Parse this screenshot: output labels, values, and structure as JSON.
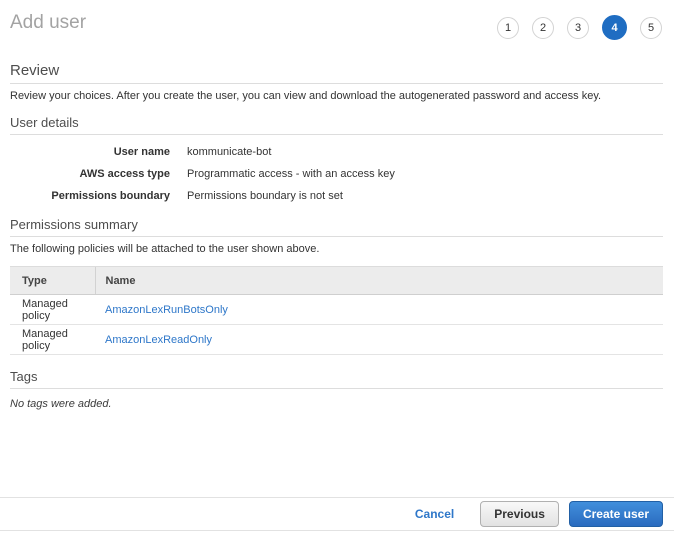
{
  "page": {
    "title": "Add user"
  },
  "steps": {
    "items": [
      "1",
      "2",
      "3",
      "4",
      "5"
    ],
    "active_step": "4"
  },
  "review": {
    "heading": "Review",
    "description": "Review your choices. After you create the user, you can view and download the autogenerated password and access key."
  },
  "user_details": {
    "heading": "User details",
    "rows": [
      {
        "label": "User name",
        "value": "kommunicate-bot"
      },
      {
        "label": "AWS access type",
        "value": "Programmatic access - with an access key"
      },
      {
        "label": "Permissions boundary",
        "value": "Permissions boundary is not set"
      }
    ]
  },
  "permissions_summary": {
    "heading": "Permissions summary",
    "description": "The following policies will be attached to the user shown above.",
    "table": {
      "columns": [
        "Type",
        "Name"
      ],
      "rows": [
        {
          "type": "Managed policy",
          "name": "AmazonLexRunBotsOnly"
        },
        {
          "type": "Managed policy",
          "name": "AmazonLexReadOnly"
        }
      ]
    }
  },
  "tags": {
    "heading": "Tags",
    "empty_message": "No tags were added."
  },
  "footer": {
    "cancel_label": "Cancel",
    "previous_label": "Previous",
    "create_label": "Create user"
  },
  "colors": {
    "title_gray": "#a3a3a3",
    "heading_gray": "#4d4d4d",
    "text": "#333333",
    "line": "#dddddd",
    "table_header_bg": "#ececec",
    "link_blue": "#2e77c9",
    "step_blue": "#1f6dc2",
    "button_blue_top": "#418fdc",
    "button_blue_bottom": "#2a6bbf"
  }
}
